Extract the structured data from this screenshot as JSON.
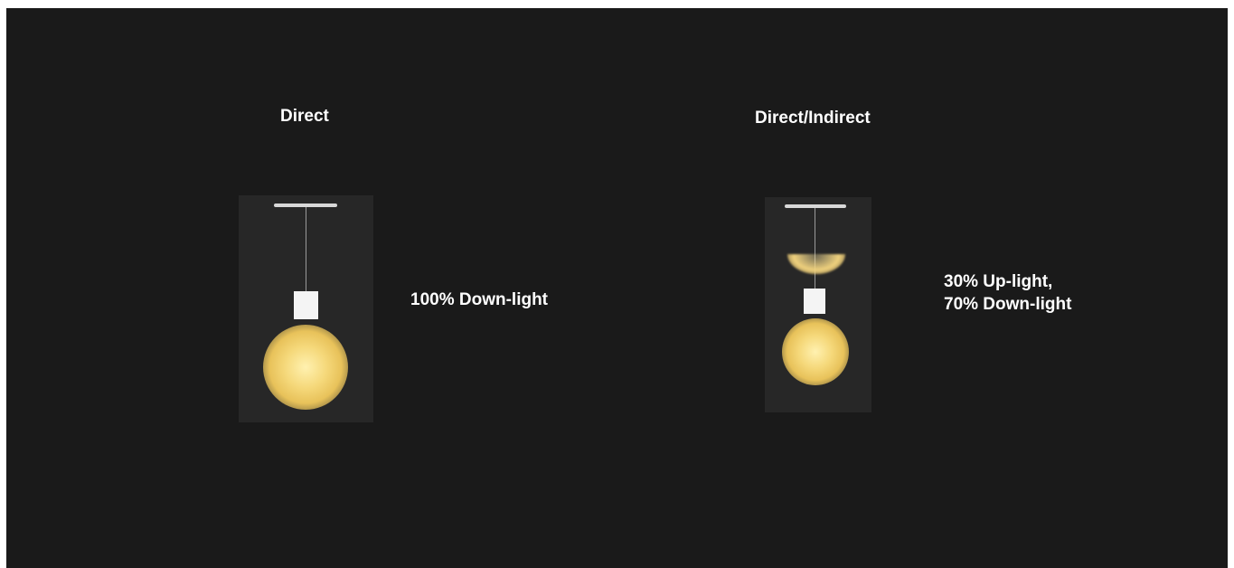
{
  "diagrams": [
    {
      "title": "Direct",
      "description_lines": [
        "100% Down-light"
      ]
    },
    {
      "title": "Direct/Indirect",
      "description_lines": [
        "30% Up-light,",
        "70% Down-light"
      ]
    }
  ],
  "colors": {
    "background": "#1a1a1a",
    "panel": "#272727",
    "glow": "#f5d87a",
    "lamp": "#f4f4f4"
  }
}
